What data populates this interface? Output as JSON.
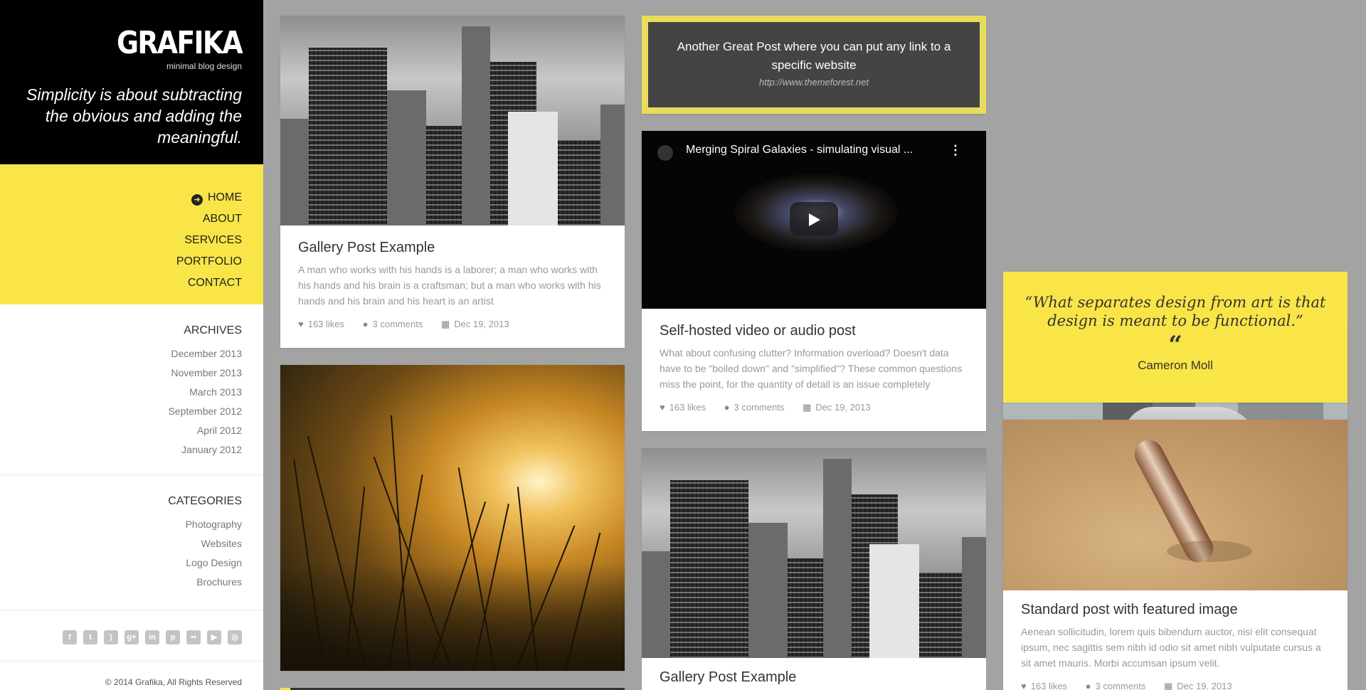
{
  "brand": {
    "logo": "GRAFIKA",
    "tagline": "minimal blog design",
    "slogan": "Simplicity is about subtracting the obvious and adding the meaningful."
  },
  "nav": {
    "items": [
      {
        "label": "HOME",
        "active": true
      },
      {
        "label": "ABOUT"
      },
      {
        "label": "SERVICES"
      },
      {
        "label": "PORTFOLIO"
      },
      {
        "label": "CONTACT"
      }
    ]
  },
  "archives": {
    "title": "ARCHIVES",
    "links": [
      "December 2013",
      "November 2013",
      "March 2013",
      "September 2012",
      "April 2012",
      "January 2012"
    ]
  },
  "categories": {
    "title": "CATEGORIES",
    "links": [
      "Photography",
      "Websites",
      "Logo Design",
      "Brochures"
    ]
  },
  "social": [
    "facebook-icon",
    "twitter-icon",
    "rss-icon",
    "google-plus-icon",
    "linkedin-icon",
    "pinterest-icon",
    "flickr-icon",
    "youtube-icon",
    "instagram-icon"
  ],
  "copyright": "© 2014 Grafika, All Rights Reserved",
  "posts": {
    "gallery1": {
      "title": "Gallery Post Example",
      "excerpt": "A man who works with his hands is a laborer; a man who works with his hands and his brain is a craftsman; but a man who works with his hands and his brain and his heart is an artist",
      "likes": "163 likes",
      "comments": "3 comments",
      "date": "Dec 19, 2013"
    },
    "link": {
      "text": "Another Great Post where you can put any link to a specific website",
      "url": "http://www.themeforest.net"
    },
    "video": {
      "video_title": "Merging Spiral Galaxies - simulating visual ...",
      "title": "Self-hosted video or audio post",
      "excerpt": "What about confusing clutter? Information overload? Doesn't data have to be \"boiled down\" and \"simplified\"? These common questions miss the point, for the quantity of detail is an issue completely",
      "likes": "163 likes",
      "comments": "3 comments",
      "date": "Dec 19, 2013"
    },
    "gallery2": {
      "title": "Gallery Post Example"
    },
    "quote": {
      "text": "“What separates design from art is that design is meant to be functional.”",
      "mark": "“",
      "author": "Cameron Moll"
    },
    "standard": {
      "title": "Standard post with featured image",
      "excerpt": "Aenean sollicitudin, lorem quis bibendum auctor, nisi elit consequat ipsum, nec sagittis sem nibh id odio sit amet nibh vulputate cursus a sit amet mauris. Morbi accumsan ipsum velit.",
      "likes": "163 likes",
      "comments": "3 comments",
      "date": "Dec 19, 2013"
    }
  },
  "colors": {
    "accent": "#f9e547",
    "background": "#a3a3a3",
    "sidebar_top": "#000000"
  }
}
